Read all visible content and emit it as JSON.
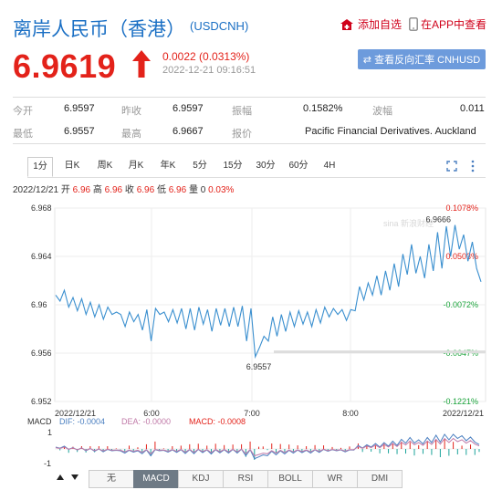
{
  "header": {
    "title": "离岸人民币（香港）",
    "code": "(USDCNH)",
    "add_watch": "添加自选",
    "app_view": "在APP中查看"
  },
  "quote": {
    "price": "6.9619",
    "change": "0.0022 (0.0313%)",
    "timestamp": "2022-12-21 09:16:51",
    "reverse_btn": "⇄ 查看反向汇率 CNHUSD"
  },
  "stats": {
    "open_label": "今开",
    "open": "6.9597",
    "prev_label": "昨收",
    "prev": "6.9597",
    "amp_label": "振幅",
    "amp": "0.1582%",
    "wave_label": "波幅",
    "wave": "0.011",
    "low_label": "最低",
    "low": "6.9557",
    "high_label": "最高",
    "high": "6.9667",
    "quote_label": "报价",
    "quote_src": "Pacific Financial Derivatives. Auckland"
  },
  "tabs": [
    "1分",
    "日K",
    "周K",
    "月K",
    "年K",
    "5分",
    "15分",
    "30分",
    "60分",
    "4H"
  ],
  "info_line": {
    "date": "2022/12/21",
    "o_label": "开",
    "o": "6.96",
    "h_label": "高",
    "h": "6.96",
    "c_label": "收",
    "c": "6.96",
    "l_label": "低",
    "l": "6.96",
    "v_label": "量",
    "v": "0",
    "pct": "0.03%"
  },
  "chart_labels": {
    "y_left": [
      "6.968",
      "6.964",
      "6.96",
      "6.956",
      "6.952"
    ],
    "y_right": [
      "0.1078%",
      "0.0503%",
      "-0.0072%",
      "-0.0647%",
      "-0.1221%"
    ],
    "x": [
      "2022/12/21",
      "6:00",
      "7:00",
      "8:00",
      "2022/12/21"
    ],
    "high_mark": "6.9666",
    "low_mark": "6.9557",
    "watermark": "sina 新浪财经"
  },
  "macd": {
    "label": "MACD",
    "dif": "DIF: -0.0004",
    "dea": "DEA: -0.0000",
    "macd": "MACD: -0.0008",
    "axis_top": "1",
    "axis_bottom": "-1"
  },
  "indicator_tabs": [
    "无",
    "MACD",
    "KDJ",
    "RSI",
    "BOLL",
    "WR",
    "DMI"
  ],
  "colors": {
    "up": "#e3221a",
    "down": "#1aa33a",
    "line": "#3a8fcf",
    "title": "#1a6fc4"
  },
  "chart_data": {
    "type": "line",
    "title": "",
    "ylim": [
      6.952,
      6.968
    ],
    "y_ticks": [
      6.968,
      6.964,
      6.96,
      6.956,
      6.952
    ],
    "x_ticks": [
      "2022/12/21",
      "6:00",
      "7:00",
      "8:00",
      "2022/12/21"
    ],
    "series": [
      {
        "values": [
          6.9608,
          6.9603,
          6.9612,
          6.9598,
          6.9606,
          6.9595,
          6.9605,
          6.9592,
          6.9602,
          6.959,
          6.96,
          6.9588,
          6.9598,
          6.9592,
          6.9594,
          6.9592,
          6.9582,
          6.9594,
          6.9586,
          6.9592,
          6.9579,
          6.9596,
          6.957,
          6.9597,
          6.9592,
          6.9594,
          6.9586,
          6.9596,
          6.9585,
          6.9597,
          6.958,
          6.9597,
          6.9579,
          6.9598,
          6.9584,
          6.9596,
          6.9578,
          6.9597,
          6.9583,
          6.9597,
          6.9582,
          6.9598,
          6.9582,
          6.9599,
          6.957,
          6.9597,
          6.9557,
          6.9565,
          6.9574,
          6.957,
          6.959,
          6.9574,
          6.9592,
          6.9578,
          6.9594,
          6.9582,
          6.9595,
          6.9584,
          6.9594,
          6.9582,
          6.9596,
          6.9585,
          6.9598,
          6.959,
          6.9597,
          6.9592,
          6.9596,
          6.9587,
          6.9596,
          6.9595,
          6.9615,
          6.9604,
          6.9618,
          6.9608,
          6.9624,
          6.9608,
          6.9628,
          6.9612,
          6.9634,
          6.9615,
          6.9642,
          6.9625,
          6.965,
          6.9626,
          6.964,
          6.9622,
          6.965,
          6.9628,
          6.966,
          6.963,
          6.9665,
          6.964,
          6.9666,
          6.9646,
          6.9658,
          6.9636,
          6.9652,
          6.963,
          6.9619
        ]
      }
    ]
  }
}
